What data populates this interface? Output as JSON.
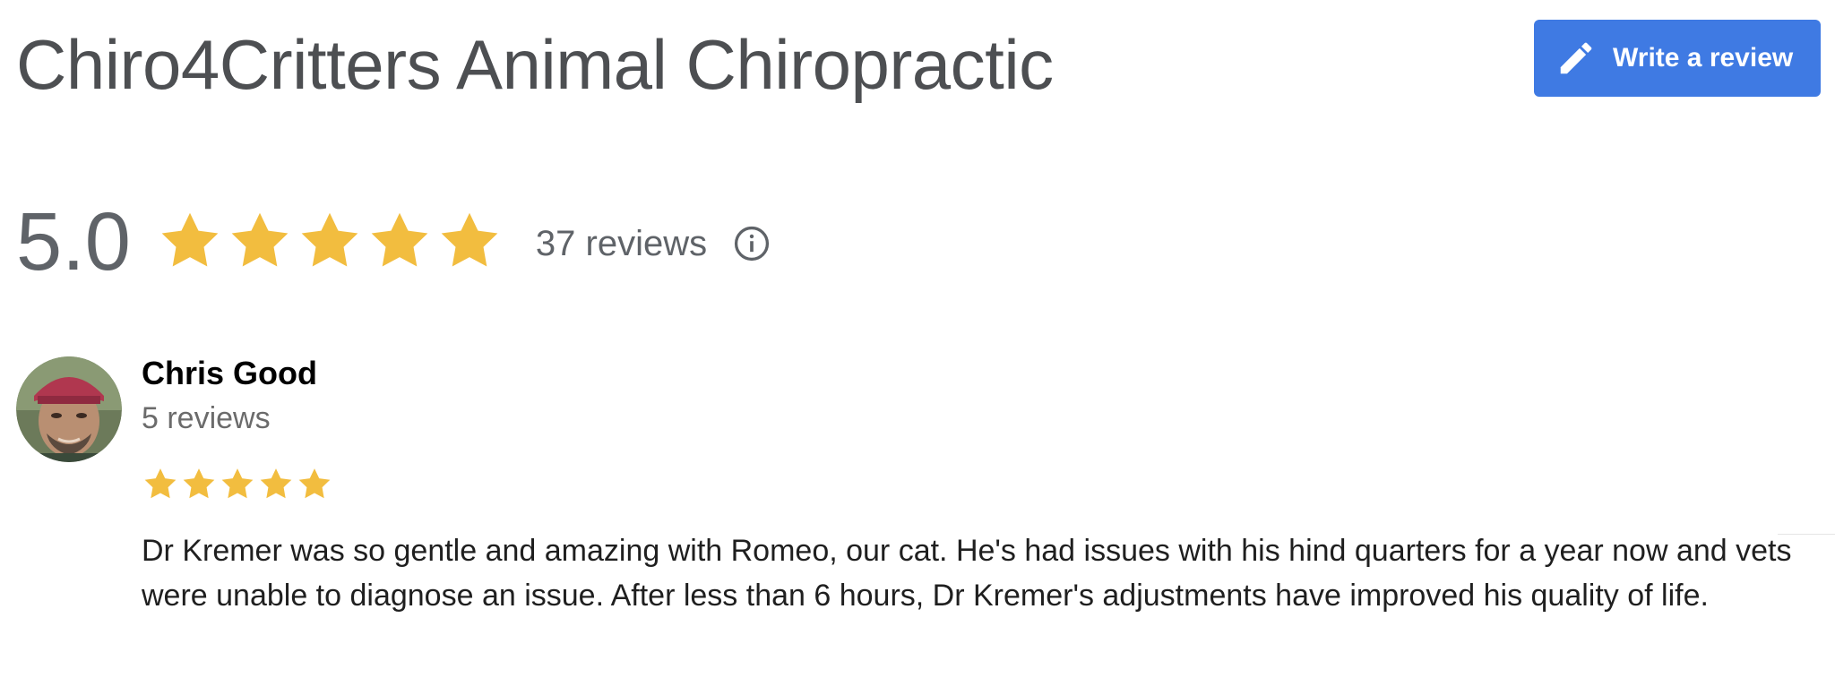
{
  "business": {
    "title": "Chiro4Critters Animal Chiropractic"
  },
  "write_review": {
    "label": "Write a review",
    "icon": "pencil-icon",
    "color": "#3f7ae3"
  },
  "summary": {
    "rating": "5.0",
    "stars": 5,
    "max_stars": 5,
    "review_count_label": "37 reviews",
    "info_icon": "info-icon",
    "star_color": "#f2bd3f"
  },
  "reviews": [
    {
      "name": "Chris Good",
      "meta": "5 reviews",
      "stars": 5,
      "text": "Dr Kremer was so gentle and amazing with Romeo, our cat. He's had issues with his hind quarters for a year now and vets were unable to diagnose an issue. After less than 6 hours, Dr Kremer's adjustments have improved his quality of life."
    }
  ]
}
